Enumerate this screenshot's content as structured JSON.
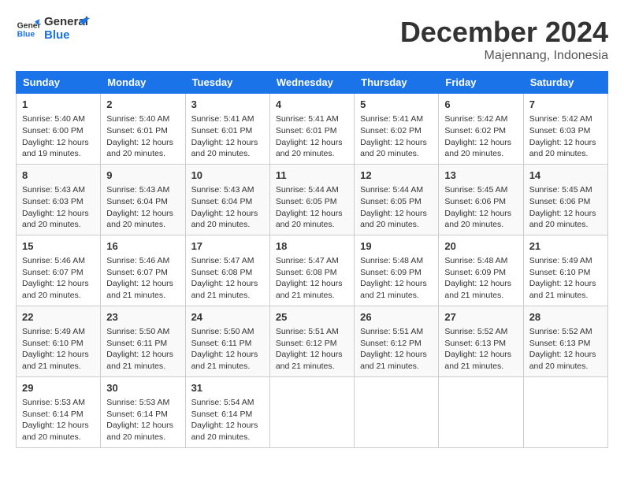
{
  "header": {
    "logo_line1": "General",
    "logo_line2": "Blue",
    "month": "December 2024",
    "location": "Majennang, Indonesia"
  },
  "days_of_week": [
    "Sunday",
    "Monday",
    "Tuesday",
    "Wednesday",
    "Thursday",
    "Friday",
    "Saturday"
  ],
  "weeks": [
    [
      {
        "day": "1",
        "info": "Sunrise: 5:40 AM\nSunset: 6:00 PM\nDaylight: 12 hours and 19 minutes."
      },
      {
        "day": "2",
        "info": "Sunrise: 5:40 AM\nSunset: 6:01 PM\nDaylight: 12 hours and 20 minutes."
      },
      {
        "day": "3",
        "info": "Sunrise: 5:41 AM\nSunset: 6:01 PM\nDaylight: 12 hours and 20 minutes."
      },
      {
        "day": "4",
        "info": "Sunrise: 5:41 AM\nSunset: 6:01 PM\nDaylight: 12 hours and 20 minutes."
      },
      {
        "day": "5",
        "info": "Sunrise: 5:41 AM\nSunset: 6:02 PM\nDaylight: 12 hours and 20 minutes."
      },
      {
        "day": "6",
        "info": "Sunrise: 5:42 AM\nSunset: 6:02 PM\nDaylight: 12 hours and 20 minutes."
      },
      {
        "day": "7",
        "info": "Sunrise: 5:42 AM\nSunset: 6:03 PM\nDaylight: 12 hours and 20 minutes."
      }
    ],
    [
      {
        "day": "8",
        "info": "Sunrise: 5:43 AM\nSunset: 6:03 PM\nDaylight: 12 hours and 20 minutes."
      },
      {
        "day": "9",
        "info": "Sunrise: 5:43 AM\nSunset: 6:04 PM\nDaylight: 12 hours and 20 minutes."
      },
      {
        "day": "10",
        "info": "Sunrise: 5:43 AM\nSunset: 6:04 PM\nDaylight: 12 hours and 20 minutes."
      },
      {
        "day": "11",
        "info": "Sunrise: 5:44 AM\nSunset: 6:05 PM\nDaylight: 12 hours and 20 minutes."
      },
      {
        "day": "12",
        "info": "Sunrise: 5:44 AM\nSunset: 6:05 PM\nDaylight: 12 hours and 20 minutes."
      },
      {
        "day": "13",
        "info": "Sunrise: 5:45 AM\nSunset: 6:06 PM\nDaylight: 12 hours and 20 minutes."
      },
      {
        "day": "14",
        "info": "Sunrise: 5:45 AM\nSunset: 6:06 PM\nDaylight: 12 hours and 20 minutes."
      }
    ],
    [
      {
        "day": "15",
        "info": "Sunrise: 5:46 AM\nSunset: 6:07 PM\nDaylight: 12 hours and 20 minutes."
      },
      {
        "day": "16",
        "info": "Sunrise: 5:46 AM\nSunset: 6:07 PM\nDaylight: 12 hours and 21 minutes."
      },
      {
        "day": "17",
        "info": "Sunrise: 5:47 AM\nSunset: 6:08 PM\nDaylight: 12 hours and 21 minutes."
      },
      {
        "day": "18",
        "info": "Sunrise: 5:47 AM\nSunset: 6:08 PM\nDaylight: 12 hours and 21 minutes."
      },
      {
        "day": "19",
        "info": "Sunrise: 5:48 AM\nSunset: 6:09 PM\nDaylight: 12 hours and 21 minutes."
      },
      {
        "day": "20",
        "info": "Sunrise: 5:48 AM\nSunset: 6:09 PM\nDaylight: 12 hours and 21 minutes."
      },
      {
        "day": "21",
        "info": "Sunrise: 5:49 AM\nSunset: 6:10 PM\nDaylight: 12 hours and 21 minutes."
      }
    ],
    [
      {
        "day": "22",
        "info": "Sunrise: 5:49 AM\nSunset: 6:10 PM\nDaylight: 12 hours and 21 minutes."
      },
      {
        "day": "23",
        "info": "Sunrise: 5:50 AM\nSunset: 6:11 PM\nDaylight: 12 hours and 21 minutes."
      },
      {
        "day": "24",
        "info": "Sunrise: 5:50 AM\nSunset: 6:11 PM\nDaylight: 12 hours and 21 minutes."
      },
      {
        "day": "25",
        "info": "Sunrise: 5:51 AM\nSunset: 6:12 PM\nDaylight: 12 hours and 21 minutes."
      },
      {
        "day": "26",
        "info": "Sunrise: 5:51 AM\nSunset: 6:12 PM\nDaylight: 12 hours and 21 minutes."
      },
      {
        "day": "27",
        "info": "Sunrise: 5:52 AM\nSunset: 6:13 PM\nDaylight: 12 hours and 21 minutes."
      },
      {
        "day": "28",
        "info": "Sunrise: 5:52 AM\nSunset: 6:13 PM\nDaylight: 12 hours and 20 minutes."
      }
    ],
    [
      {
        "day": "29",
        "info": "Sunrise: 5:53 AM\nSunset: 6:14 PM\nDaylight: 12 hours and 20 minutes."
      },
      {
        "day": "30",
        "info": "Sunrise: 5:53 AM\nSunset: 6:14 PM\nDaylight: 12 hours and 20 minutes."
      },
      {
        "day": "31",
        "info": "Sunrise: 5:54 AM\nSunset: 6:14 PM\nDaylight: 12 hours and 20 minutes."
      },
      null,
      null,
      null,
      null
    ]
  ]
}
